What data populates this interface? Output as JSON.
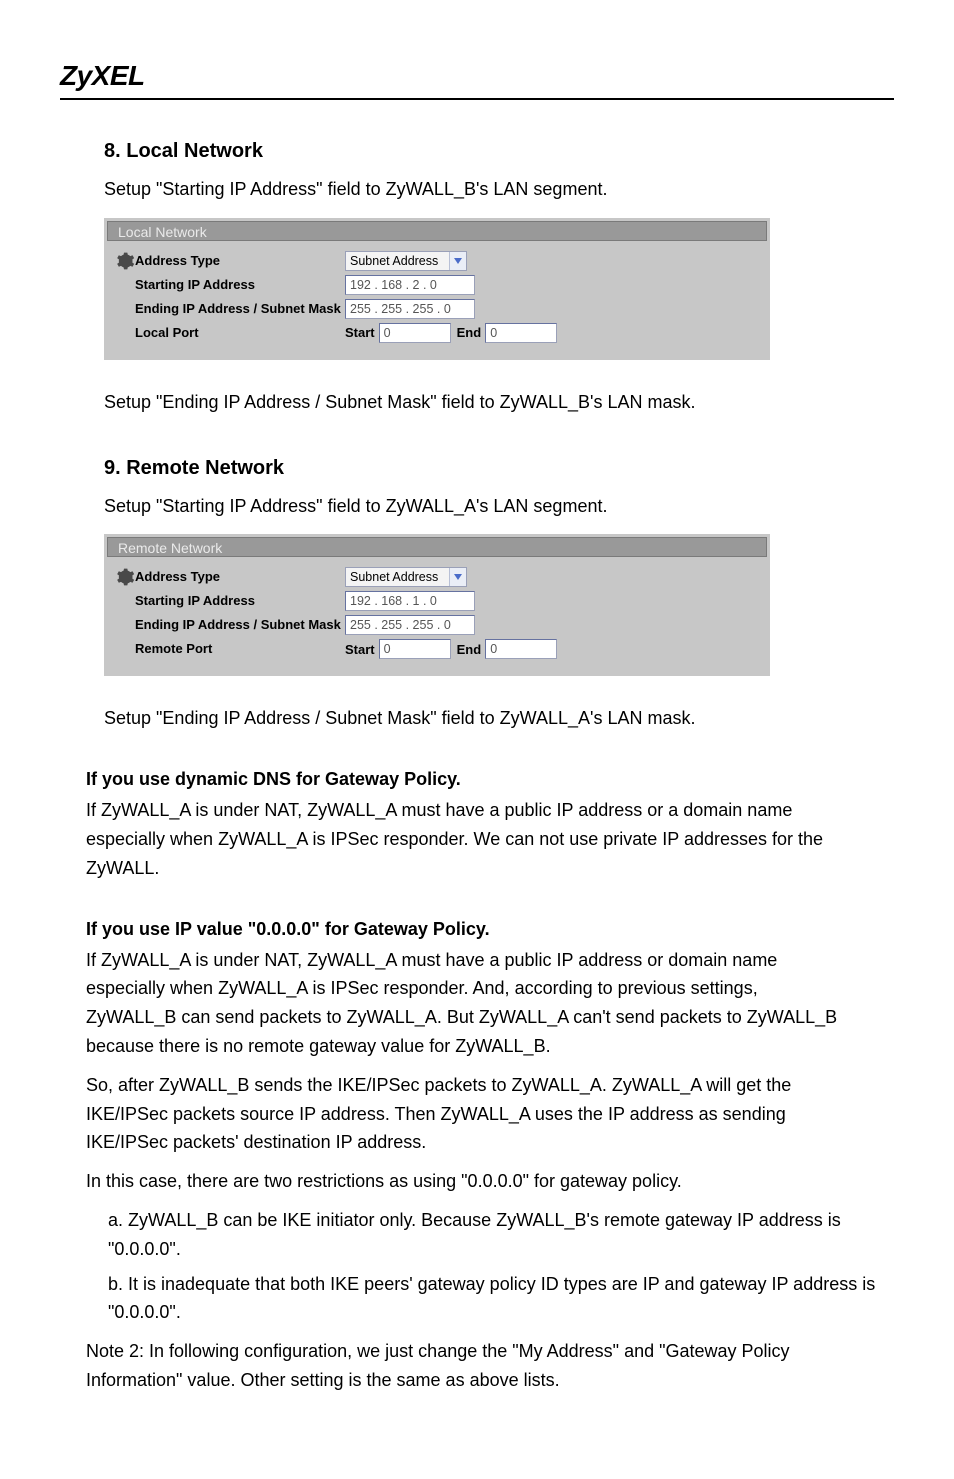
{
  "brand": "ZyXEL",
  "local_section": {
    "title": "8. Local Network",
    "intro": "Setup \"Starting IP Address\" field to ZyWALL_B's LAN segment.",
    "panel_title": "Local Network",
    "labels": {
      "address_type": "Address Type",
      "starting_ip": "Starting IP Address",
      "ending_mask": "Ending IP Address / Subnet Mask",
      "port_label": "Local Port",
      "start": "Start",
      "end": "End"
    },
    "values": {
      "address_type": "Subnet Address",
      "starting_ip": "192 . 168 .   2   .   0",
      "ending_mask": "255 . 255 . 255 .   0",
      "start_port": "0",
      "end_port": "0"
    },
    "after": "Setup \"Ending IP Address / Subnet Mask\" field to ZyWALL_B's LAN mask."
  },
  "remote_section": {
    "title": "9. Remote Network",
    "intro": "Setup \"Starting IP Address\" field to ZyWALL_A's LAN segment.",
    "panel_title": "Remote Network",
    "labels": {
      "address_type": "Address Type",
      "starting_ip": "Starting IP Address",
      "ending_mask": "Ending IP Address / Subnet Mask",
      "port_label": "Remote Port",
      "start": "Start",
      "end": "End"
    },
    "values": {
      "address_type": "Subnet Address",
      "starting_ip": "192 . 168 .   1   .   0",
      "ending_mask": "255 . 255 . 255 .   0",
      "start_port": "0",
      "end_port": "0"
    },
    "after": "Setup \"Ending IP Address / Subnet Mask\" field to ZyWALL_A's LAN mask."
  },
  "guidance": {
    "heading1": "If you use dynamic DNS for Gateway Policy.",
    "para1": "If ZyWALL_A is under NAT, ZyWALL_A must have a public IP address or a domain name especially when ZyWALL_A is IPSec responder. We can not use private IP addresses for the ZyWALL.",
    "heading2": "If you use IP value \"0.0.0.0\" for Gateway Policy.",
    "para2": "If ZyWALL_A is under NAT, ZyWALL_A must have a public IP address or domain name especially when ZyWALL_A is IPSec responder. And, according to previous settings, ZyWALL_B can send packets to ZyWALL_A. But ZyWALL_A can't send packets to ZyWALL_B because there is no remote gateway value for ZyWALL_B.",
    "para3": "So, after ZyWALL_B sends the IKE/IPSec packets to ZyWALL_A. ZyWALL_A will get the IKE/IPSec packets source IP address. Then ZyWALL_A uses the IP address as sending IKE/IPSec packets' destination IP address.",
    "para4": "In this case, there are two restrictions as using \"0.0.0.0\" for gateway policy.",
    "bullet1": "a. ZyWALL_B can be IKE initiator only. Because ZyWALL_B's remote gateway IP address is \"0.0.0.0\".",
    "bullet2": "b. It is inadequate that both IKE peers' gateway policy ID types are IP and gateway IP address is \"0.0.0.0\".",
    "note": "Note 2: In following configuration, we just change the \"My Address\" and \"Gateway Policy Information\" value. Other setting is the same as above lists."
  }
}
